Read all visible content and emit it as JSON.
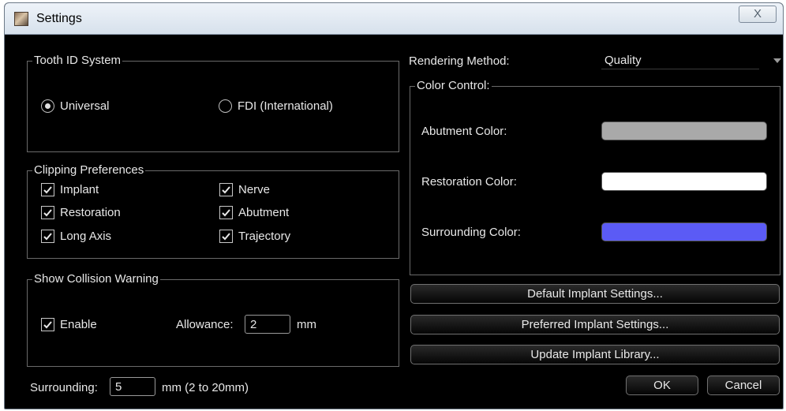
{
  "window": {
    "title": "Settings",
    "close_glyph": "X"
  },
  "tooth_id": {
    "title": "Tooth ID System",
    "options": [
      {
        "label": "Universal",
        "selected": true
      },
      {
        "label": "FDI (International)",
        "selected": false
      }
    ]
  },
  "clipping": {
    "title": "Clipping Preferences",
    "items": [
      {
        "label": "Implant",
        "checked": true
      },
      {
        "label": "Nerve",
        "checked": true
      },
      {
        "label": "Restoration",
        "checked": true
      },
      {
        "label": "Abutment",
        "checked": true
      },
      {
        "label": "Long Axis",
        "checked": true
      },
      {
        "label": "Trajectory",
        "checked": true
      }
    ]
  },
  "collision": {
    "title": "Show Collision Warning",
    "enable_label": "Enable",
    "enable_checked": true,
    "allowance_label": "Allowance:",
    "allowance_value": "2",
    "allowance_unit": "mm"
  },
  "surrounding": {
    "label": "Surrounding:",
    "value": "5",
    "unit": "mm (2 to 20mm)"
  },
  "rendering": {
    "label": "Rendering Method:",
    "value": "Quality"
  },
  "color_control": {
    "title": "Color Control:",
    "abutment_label": "Abutment Color:",
    "abutment_color": "#a9a9a9",
    "restoration_label": "Restoration Color:",
    "restoration_color": "#ffffff",
    "surrounding_label": "Surrounding Color:",
    "surrounding_color": "#5b5bf5"
  },
  "buttons": {
    "default_implant": "Default Implant Settings...",
    "preferred_implant": "Preferred Implant Settings...",
    "update_library": "Update Implant Library...",
    "ok": "OK",
    "cancel": "Cancel"
  }
}
